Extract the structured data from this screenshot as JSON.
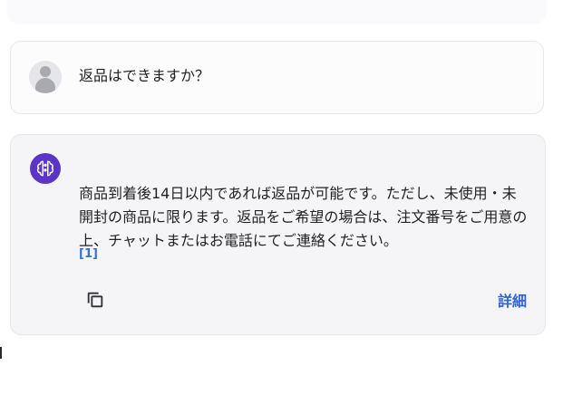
{
  "user_message": {
    "text": "返品はできますか？"
  },
  "assistant_message": {
    "text": "商品到着後14日以内であれば返品が可能です。ただし、未使用・未開封の商品に限ります。返品をご希望の場合は、注文番号をご用意の上、チャットまたはお電話にてご連絡ください。",
    "citation": "[1]",
    "detail_label": "詳細"
  },
  "icons": {
    "user_avatar": "person-icon",
    "assistant_avatar": "brain-icon",
    "copy": "copy-icon"
  },
  "colors": {
    "accent": "#2f63d6",
    "assistant_avatar_bg": "#5a35c8",
    "citation": "#3a6fd8"
  }
}
